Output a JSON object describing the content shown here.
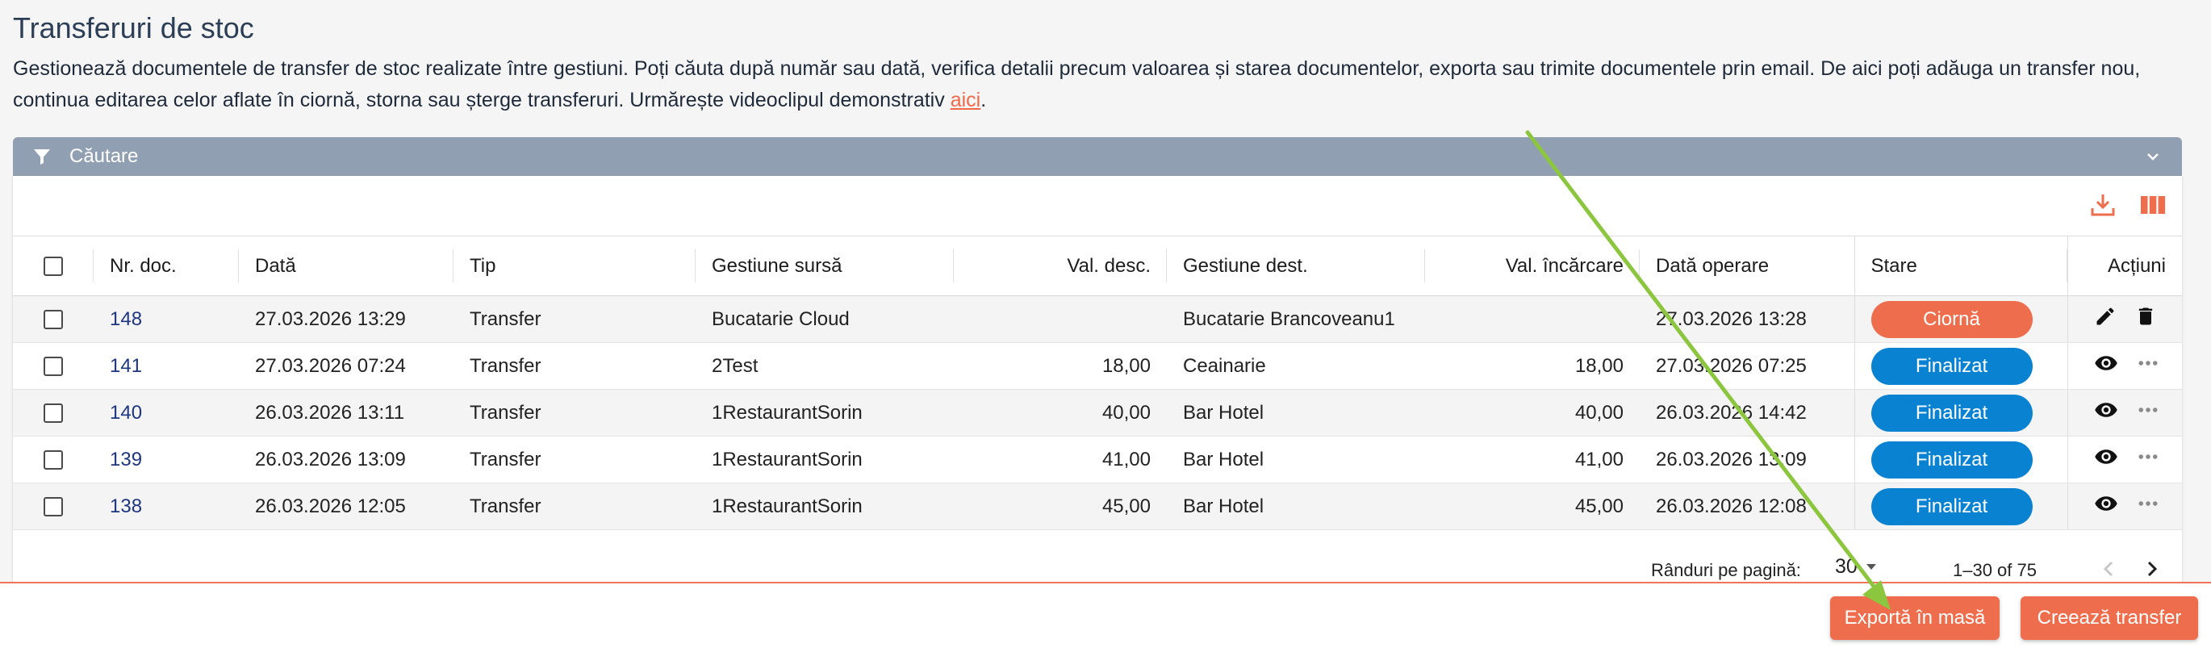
{
  "page": {
    "title": "Transferuri de stoc",
    "description_main": "Gestionează documentele de transfer de stoc realizate între gestiuni. Poți căuta după număr sau dată, verifica detalii precum valoarea și starea documentelor, exporta sau trimite documentele prin email. De aici poți adăuga un transfer nou, continua editarea celor aflate în ciornă, storna sau șterge transferuri. Urmărește videoclipul demonstrativ ",
    "description_link": "aici",
    "description_end": "."
  },
  "search": {
    "label": "Căutare"
  },
  "toolbar": {
    "download_icon": "download-icon",
    "columns_icon": "columns-icon"
  },
  "table": {
    "headers": {
      "nr_doc": "Nr. doc.",
      "data": "Dată",
      "tip": "Tip",
      "gestiune_sursa": "Gestiune sursă",
      "val_desc": "Val. desc.",
      "gestiune_dest": "Gestiune dest.",
      "val_incarcare": "Val. încărcare",
      "data_operare": "Dată operare",
      "stare": "Stare",
      "actiuni": "Acțiuni"
    },
    "rows": [
      {
        "nr_doc": "148",
        "data": "27.03.2026 13:29",
        "tip": "Transfer",
        "gestiune_sursa": "Bucatarie Cloud",
        "val_desc": "",
        "gestiune_dest": "Bucatarie Brancoveanu1",
        "val_incarcare": "",
        "data_operare": "27.03.2026 13:28",
        "stare": "Ciornă"
      },
      {
        "nr_doc": "141",
        "data": "27.03.2026 07:24",
        "tip": "Transfer",
        "gestiune_sursa": "2Test",
        "val_desc": "18,00",
        "gestiune_dest": "Ceainarie",
        "val_incarcare": "18,00",
        "data_operare": "27.03.2026 07:25",
        "stare": "Finalizat"
      },
      {
        "nr_doc": "140",
        "data": "26.03.2026 13:11",
        "tip": "Transfer",
        "gestiune_sursa": "1RestaurantSorin",
        "val_desc": "40,00",
        "gestiune_dest": "Bar Hotel",
        "val_incarcare": "40,00",
        "data_operare": "26.03.2026 14:42",
        "stare": "Finalizat"
      },
      {
        "nr_doc": "139",
        "data": "26.03.2026 13:09",
        "tip": "Transfer",
        "gestiune_sursa": "1RestaurantSorin",
        "val_desc": "41,00",
        "gestiune_dest": "Bar Hotel",
        "val_incarcare": "41,00",
        "data_operare": "26.03.2026 13:09",
        "stare": "Finalizat"
      },
      {
        "nr_doc": "138",
        "data": "26.03.2026 12:05",
        "tip": "Transfer",
        "gestiune_sursa": "1RestaurantSorin",
        "val_desc": "45,00",
        "gestiune_dest": "Bar Hotel",
        "val_incarcare": "45,00",
        "data_operare": "26.03.2026 12:08",
        "stare": "Finalizat"
      }
    ]
  },
  "status_colors": {
    "Ciornă": "#ee6d4c",
    "Finalizat": "#0a82d2"
  },
  "pagination": {
    "rows_per_page_label": "Rânduri pe pagină:",
    "rows_per_page_value": "30",
    "range_label": "1–30 of 75"
  },
  "footer": {
    "export_label": "Exportă în masă",
    "create_label": "Creează transfer"
  },
  "colors": {
    "accent": "#ee6d4c",
    "search_bar": "#919fb2",
    "link": "#1e3580",
    "annotation_arrow": "#8cc63f"
  }
}
